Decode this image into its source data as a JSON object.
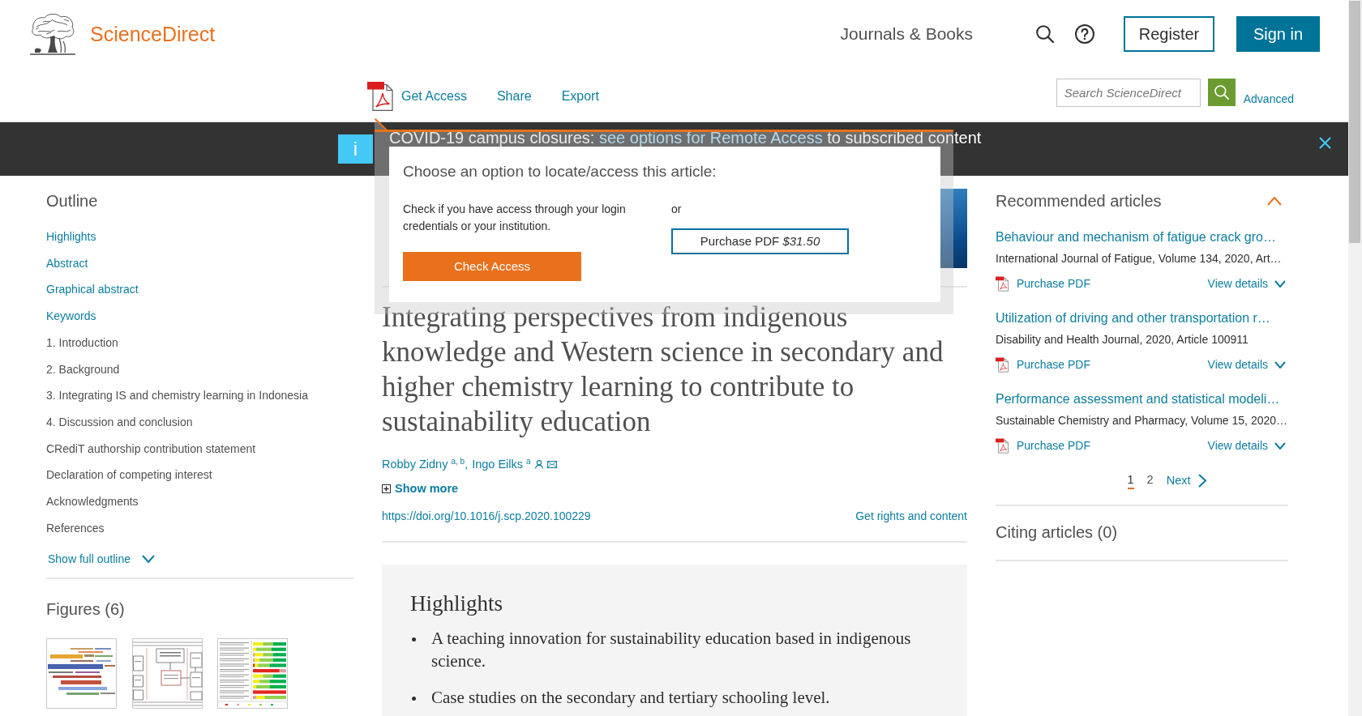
{
  "header": {
    "brand": "ScienceDirect",
    "nav_link": "Journals & Books",
    "register": "Register",
    "sign_in": "Sign in"
  },
  "toolbar": {
    "actions": [
      {
        "label": "Get Access",
        "kind": "pdf"
      },
      {
        "label": "Share",
        "kind": "plain"
      },
      {
        "label": "Export",
        "kind": "plain"
      }
    ],
    "search": {
      "placeholder": "Search ScienceDirect"
    },
    "advanced": "Advanced"
  },
  "banner": {
    "info": "i",
    "text": "COVID-19 campus closures:",
    "link": "see options for Remote Access",
    "text_end": "to subscribed content"
  },
  "access_popup": {
    "title": "Choose an option to locate/access this article:",
    "description": "Check if you have access through your login credentials or your institution.",
    "check_button": "Check Access",
    "separator": "or",
    "purchase_button": "Purchase PDF *$31.50*"
  },
  "outline": {
    "title": "Outline",
    "items": [
      {
        "label": "Highlights",
        "kind": "link"
      },
      {
        "label": "Abstract",
        "kind": "link"
      },
      {
        "label": "Graphical abstract",
        "kind": "link"
      },
      {
        "label": "Keywords",
        "kind": "link"
      },
      {
        "label": "1. Introduction",
        "kind": "section"
      },
      {
        "label": "2. Background",
        "kind": "section"
      },
      {
        "label": "3. Integrating IS and chemistry learning in Indonesia",
        "kind": "section"
      },
      {
        "label": "4. Discussion and conclusion",
        "kind": "section"
      },
      {
        "label": "CRediT authorship contribution statement",
        "kind": "section"
      },
      {
        "label": "Declaration of competing interest",
        "kind": "section"
      },
      {
        "label": "Acknowledgments",
        "kind": "section"
      },
      {
        "label": "References",
        "kind": "section"
      }
    ],
    "show_full": "Show full outline"
  },
  "figures": {
    "title": "Figures (6)",
    "thumbnails": [
      {
        "kind": "word_cloud"
      },
      {
        "kind": "flowchart"
      },
      {
        "kind": "rating_table"
      }
    ]
  },
  "article": {
    "title": "Integrating perspectives from indigenous knowledge and Western science in secondary and higher chemistry learning to contribute to sustainability education",
    "authors": [
      {
        "name": "Robby Zidny $^{a, b}$,",
        "corresponding": false
      },
      {
        "name": "Ingo Eilks $^{a}$",
        "corresponding": true
      }
    ],
    "show_more": "Show more",
    "doi": "https://doi.org/10.1016/j.scp.2020.100229",
    "rights": "Get rights and content",
    "highlights": {
      "title": "Highlights",
      "items": [
        "A teaching innovation for sustainability education based in indigenous science.",
        "Case studies on the secondary and tertiary schooling level."
      ]
    }
  },
  "recommended": {
    "title": "Recommended articles",
    "expanded": true,
    "articles": [
      {
        "title": "Behaviour and mechanism of fatigue crack gro…",
        "source": "International Journal of Fatigue, Volume 134, 2020, Art…",
        "purchase": "Purchase PDF",
        "details": "View details"
      },
      {
        "title": "Utilization of driving and other transportation r…",
        "source": "Disability and Health Journal, 2020, Article 100911",
        "purchase": "Purchase PDF",
        "details": "View details"
      },
      {
        "title": "Performance assessment and statistical modeli…",
        "source": "Sustainable Chemistry and Pharmacy, Volume 15, 2020…",
        "purchase": "Purchase PDF",
        "details": "View details"
      }
    ],
    "pagination": {
      "pages": [
        {
          "label": "1",
          "selected": true
        },
        {
          "label": "2",
          "selected": false
        }
      ],
      "next": "Next"
    }
  },
  "citing": {
    "title": "Citing articles (0)"
  }
}
